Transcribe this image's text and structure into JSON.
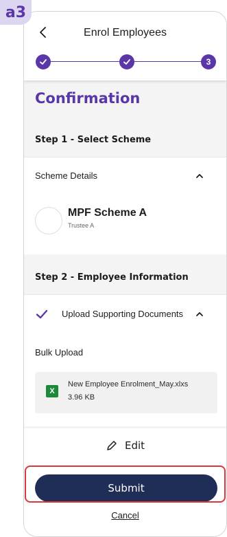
{
  "annotation": {
    "badge": "a3"
  },
  "header": {
    "title": "Enrol Employees",
    "current_step": "3"
  },
  "page": {
    "heading": "Confirmation"
  },
  "step1": {
    "title": "Step 1 - Select Scheme",
    "details_label": "Scheme Details",
    "scheme_name": "MPF Scheme A",
    "trustee": "Trustee A"
  },
  "step2": {
    "title": "Step 2 - Employee Information",
    "upload_label": "Upload Supporting Documents",
    "bulk_label": "Bulk Upload",
    "file": {
      "icon_letter": "X",
      "name": "New Employee Enrolment_May.xlxs",
      "size": "3.96 KB"
    }
  },
  "actions": {
    "edit_label": "Edit",
    "submit_label": "Submit",
    "cancel_label": "Cancel"
  },
  "colors": {
    "brand": "#5a36a8",
    "primary_button": "#1e2e57",
    "highlight": "#d9373b",
    "excel": "#1d8a3b"
  }
}
